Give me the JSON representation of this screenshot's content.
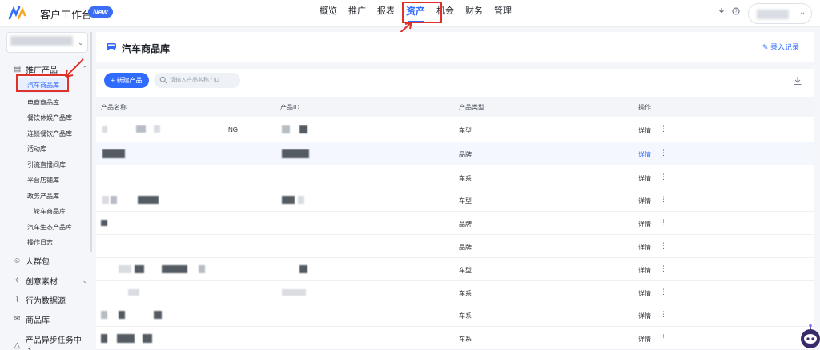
{
  "header": {
    "brand": "客户工作台",
    "new_badge": "New",
    "nav": [
      "概览",
      "推广",
      "报表",
      "资产",
      "机会",
      "财务",
      "管理"
    ],
    "active_nav": "资产",
    "icons": [
      "download-icon",
      "help-icon"
    ]
  },
  "sidebar": {
    "groups": [
      {
        "label": "推广产品",
        "icon": "product-icon",
        "expanded": true
      },
      {
        "label": "人群包",
        "icon": "audience-icon"
      },
      {
        "label": "创意素材",
        "icon": "creative-icon",
        "expanded": false
      },
      {
        "label": "行为数据源",
        "icon": "chart-icon"
      },
      {
        "label": "商品库",
        "icon": "mail-icon"
      },
      {
        "label": "产品异步任务中心",
        "icon": "task-icon"
      }
    ],
    "items": [
      "汽车商品库",
      "电商商品库",
      "餐饮休娱产品库",
      "连锁餐饮产品库",
      "活动库",
      "引流直播间库",
      "平台店铺库",
      "政务产品库",
      "二轮车商品库",
      "汽车生态产品库",
      "操作日志"
    ],
    "active_item": "汽车商品库"
  },
  "page": {
    "title": "汽车商品库",
    "record_link": "录入记录",
    "new_button": "+ 新建产品",
    "search_placeholder": "请输入产品名称 / ID"
  },
  "table": {
    "columns": [
      "产品名称",
      "产品ID",
      "产品类型",
      "操作"
    ],
    "rows": [
      {
        "name_suffix": "NG",
        "type": "车型",
        "action": "详情"
      },
      {
        "name_suffix": "",
        "type": "品牌",
        "action": "详情"
      },
      {
        "name_suffix": "",
        "type": "车系",
        "action": "详情"
      },
      {
        "name_suffix": "",
        "type": "车型",
        "action": "详情"
      },
      {
        "name_suffix": "",
        "type": "品牌",
        "action": "详情"
      },
      {
        "name_suffix": "",
        "type": "品牌",
        "action": "详情"
      },
      {
        "name_suffix": "",
        "type": "车型",
        "action": "详情"
      },
      {
        "name_suffix": "",
        "type": "车系",
        "action": "详情"
      },
      {
        "name_suffix": "",
        "type": "车系",
        "action": "详情"
      },
      {
        "name_suffix": "",
        "type": "车系",
        "action": "详情"
      }
    ],
    "more_icon": "⋮"
  },
  "colors": {
    "accent": "#2f6bff",
    "annotation": "#e0302a"
  }
}
